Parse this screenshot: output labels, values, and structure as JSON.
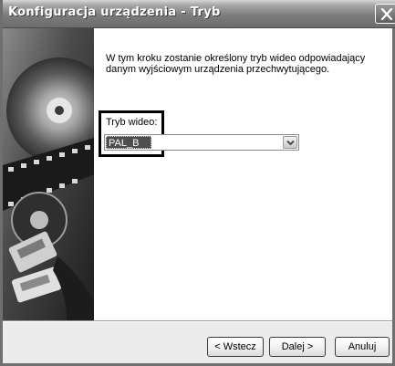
{
  "window": {
    "title": "Konfiguracja urządzenia - Tryb",
    "close_symbol": "×"
  },
  "content": {
    "description": "W tym kroku zostanie określony tryb wideo odpowiadający danym wyjściowym urządzenia przechwytującego.",
    "video_mode": {
      "label": "Tryb wideo:",
      "selected_value": "PAL_B"
    }
  },
  "buttons": {
    "back": "< Wstecz",
    "next": "Dalej >",
    "cancel": "Anuluj"
  },
  "icons": {
    "close": "close-icon",
    "dropdown": "chevron-down-icon",
    "side_image": "video-capture-illustration"
  }
}
